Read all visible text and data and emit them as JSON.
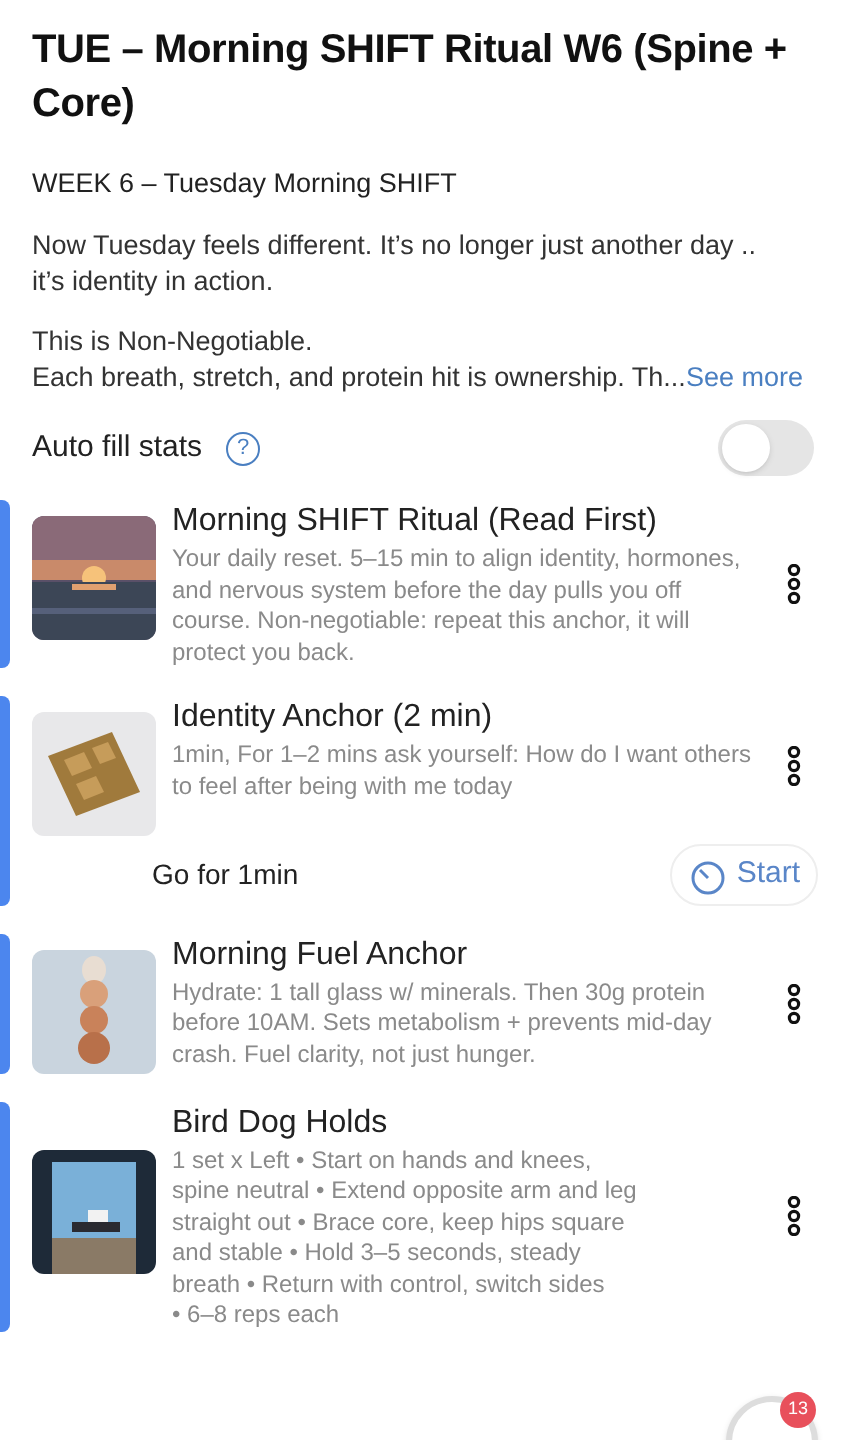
{
  "title": "TUE – Morning SHIFT Ritual W6 (Spine + Core)",
  "subtitle": "WEEK 6 – Tuesday Morning SHIFT",
  "intro": "Now Tuesday feels different. It’s no longer just another day .. it’s identity in action.",
  "body_lines": [
    "This is Non-Negotiable.",
    "Each breath, stretch, and protein hit is ownership. Th..."
  ],
  "see_more": "See more",
  "auto_fill": {
    "label": "Auto fill stats",
    "help": "?",
    "on": false
  },
  "items": [
    {
      "title": "Morning SHIFT Ritual (Read First)",
      "description": "Your daily reset. 5–15 min to align identity, hormones, and nervous system before the day pulls you off course. Non-negotiable: repeat this anchor, it will protect you back.",
      "kind": "picture"
    },
    {
      "title": "Identity Anchor (2 min)",
      "description": "1min, For 1–2 mins ask yourself: How do I want others to feel after being with me today",
      "kind": "picture",
      "footer": {
        "label": "Go for 1min",
        "button": "Start"
      }
    },
    {
      "title": "Morning Fuel Anchor",
      "description": "Hydrate: 1 tall glass w/ minerals. Then 30g protein before 10AM. Sets metabolism + prevents mid-day crash. Fuel clarity, not just hunger.",
      "kind": "picture"
    },
    {
      "title": "Bird Dog Holds",
      "description": "1 set x Left  •  Start on hands and knees,\nspine neutral  •  Extend opposite arm and leg\nstraight out  •  Brace core, keep hips square\nand stable  •  Hold 3–5 seconds, steady\nbreath  •  Return with control, switch sides\n•  6–8 reps each",
      "kind": "picture"
    }
  ],
  "fab_badge": "13"
}
